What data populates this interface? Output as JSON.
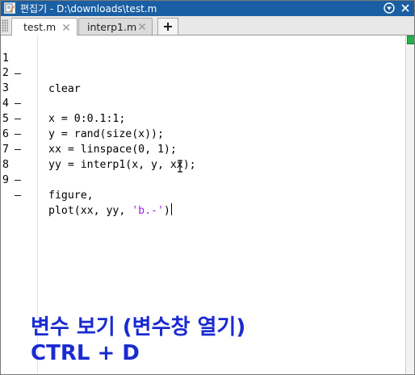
{
  "window": {
    "title": "편집기 - D:\\downloads\\test.m",
    "icons": [
      "editor-app-icon",
      "dock-menu-icon"
    ]
  },
  "tabs": [
    {
      "label": "test.m",
      "active": true,
      "close_icon": "close-icon"
    },
    {
      "label": "interp1.m",
      "active": false,
      "close_icon": "close-icon"
    }
  ],
  "add_tab": {
    "label": "+"
  },
  "editor": {
    "lines": [
      {
        "number": "1",
        "marker": "–",
        "code": "clear"
      },
      {
        "number": "2",
        "marker": "",
        "code": ""
      },
      {
        "number": "3",
        "marker": "–",
        "code": "x = 0:0.1:1;"
      },
      {
        "number": "4",
        "marker": "–",
        "code": "y = rand(size(x));"
      },
      {
        "number": "5",
        "marker": "–",
        "code": "xx = linspace(0, 1);"
      },
      {
        "number": "6",
        "marker": "–",
        "code": "yy = interp1(x, y, xx);"
      },
      {
        "number": "7",
        "marker": "",
        "code": ""
      },
      {
        "number": "8",
        "marker": "–",
        "code": "figure,"
      },
      {
        "number": "9",
        "marker": "–",
        "code_before": "plot(xx, yy, ",
        "code_string": "'b.-'",
        "code_after": ")"
      }
    ],
    "string_color": "#a020f0"
  },
  "status": {
    "indicator_color": "#22b14c"
  },
  "overlay": {
    "line1": "변수 보기 (변수창 열기)",
    "line2": "CTRL + D",
    "color": "#1a2bd0"
  },
  "colors": {
    "titlebar": "#1a5fa3",
    "tab_active": "#ffffff",
    "tab_inactive": "#dcdcdc"
  }
}
